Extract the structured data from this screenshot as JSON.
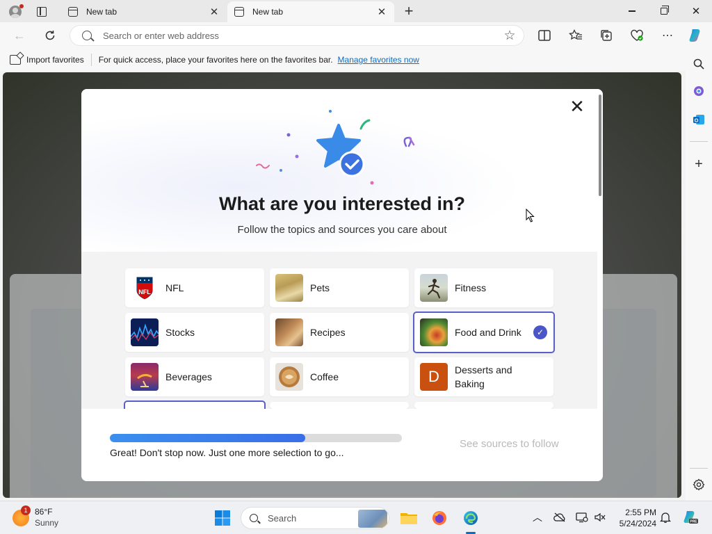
{
  "browser": {
    "tabs": [
      {
        "label": "New tab",
        "active": false
      },
      {
        "label": "New tab",
        "active": true
      }
    ],
    "address_placeholder": "Search or enter web address",
    "favorites_bar": {
      "import_label": "Import favorites",
      "hint": "For quick access, place your favorites here on the favorites bar.",
      "manage_link": "Manage favorites now"
    }
  },
  "modal": {
    "title": "What are you interested in?",
    "subtitle": "Follow the topics and sources you care about",
    "topics": [
      {
        "label": "NFL",
        "selected": false,
        "thumb": "nfl-logo"
      },
      {
        "label": "Pets",
        "selected": false,
        "thumb": "pets-photo"
      },
      {
        "label": "Fitness",
        "selected": false,
        "thumb": "fitness-photo"
      },
      {
        "label": "Stocks",
        "selected": false,
        "thumb": "stocks-photo"
      },
      {
        "label": "Recipes",
        "selected": false,
        "thumb": "recipes-photo"
      },
      {
        "label": "Food and Drink",
        "selected": true,
        "thumb": "food-photo"
      },
      {
        "label": "Beverages",
        "selected": false,
        "thumb": "beverages-photo"
      },
      {
        "label": "Coffee",
        "selected": false,
        "thumb": "coffee-photo"
      },
      {
        "label": "Desserts and Baking",
        "selected": false,
        "thumb": "letter-d",
        "letter": "D"
      }
    ],
    "progress": {
      "value": 0.67,
      "text": "Great! Don't stop now. Just one more selection to go..."
    },
    "see_sources_label": "See sources to follow"
  },
  "taskbar": {
    "weather": {
      "temp": "86°F",
      "condition": "Sunny",
      "badge": "1"
    },
    "search_label": "Search",
    "clock": {
      "time": "2:55 PM",
      "date": "5/24/2024"
    }
  },
  "colors": {
    "accent": "#4a55c7",
    "progress": "#3b7cec",
    "link": "#0f6cbd"
  }
}
